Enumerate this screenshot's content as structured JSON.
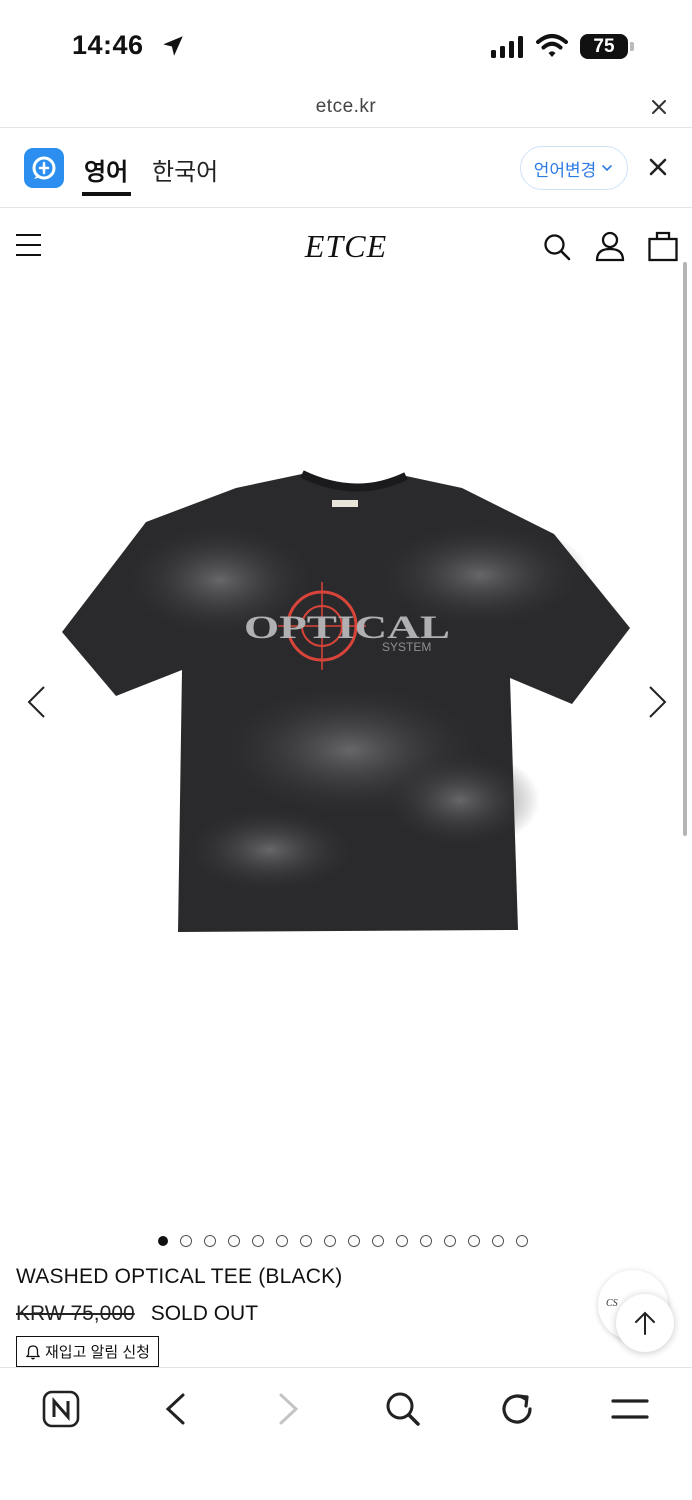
{
  "status_bar": {
    "time": "14:46",
    "battery": "75"
  },
  "url_bar": {
    "domain": "etce.kr"
  },
  "translate_bar": {
    "tabs": [
      {
        "label": "영어"
      },
      {
        "label": "한국어"
      }
    ],
    "change_language": "언어변경"
  },
  "site": {
    "logo": "ETCE"
  },
  "product": {
    "image_print": {
      "main": "OPTICAL",
      "sub": "SYSTEM"
    },
    "gallery_count": 16,
    "gallery_active": 1,
    "name": "WASHED OPTICAL TEE (BLACK)",
    "price": "KRW 75,000",
    "status": "SOLD OUT",
    "restock_label": "재입고 알림 신청"
  },
  "floating": {
    "cs_label": "CS"
  },
  "colors": {
    "accent_blue": "#2c8ff0",
    "shirt": "#2a2a2c",
    "crosshair": "#d9443a"
  }
}
